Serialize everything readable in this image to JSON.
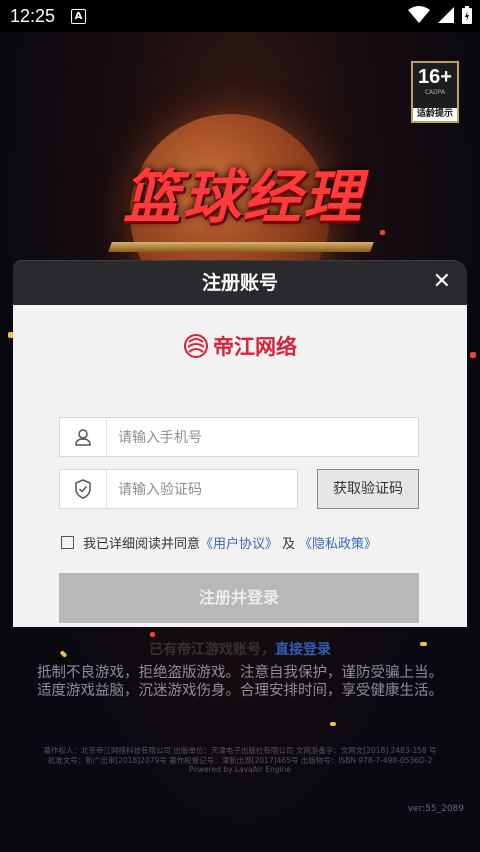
{
  "status_bar": {
    "time": "12:25",
    "notification_icon": "A"
  },
  "game": {
    "logo_text": "篮球经理",
    "age_rating": "16+",
    "age_sub": "CADPA",
    "age_tip": "适龄提示",
    "health_advice_line1": "抵制不良游戏，拒绝盗版游戏。注意自我保护，谨防受骗上当。",
    "health_advice_line2": "适度游戏益脑，沉迷游戏伤身。合理安排时间，享受健康生活。",
    "footer_line1": "著作权人：北京帝江网络科技有限公司  出版单位：天津电子出版社有限公司  文网游备字：文网文[2018] 2483-258 号",
    "footer_line2": "批准文号：新广出审[2018]2079号    著作权登记号：津新出游[2017]465号    出版物号：ISBN 978-7-498-0536D-2",
    "footer_line3": "Powered by LavaAir Engine",
    "version": "ver:55_2089"
  },
  "modal": {
    "title": "注册账号",
    "close": "✕",
    "brand": "帝江网络",
    "phone_placeholder": "请输入手机号",
    "code_placeholder": "请输入验证码",
    "get_code": "获取验证码",
    "agree_prefix": "我已详细阅读并同意",
    "user_agreement": "《用户协议》",
    "and": "及",
    "privacy_policy": "《隐私政策》",
    "submit": "注册并登录",
    "have_account": "已有帝江游戏账号，",
    "login_link": "直接登录"
  },
  "colors": {
    "brand_red": "#d8213a",
    "link_blue": "#3a69b3",
    "modal_header": "#2a292d"
  }
}
